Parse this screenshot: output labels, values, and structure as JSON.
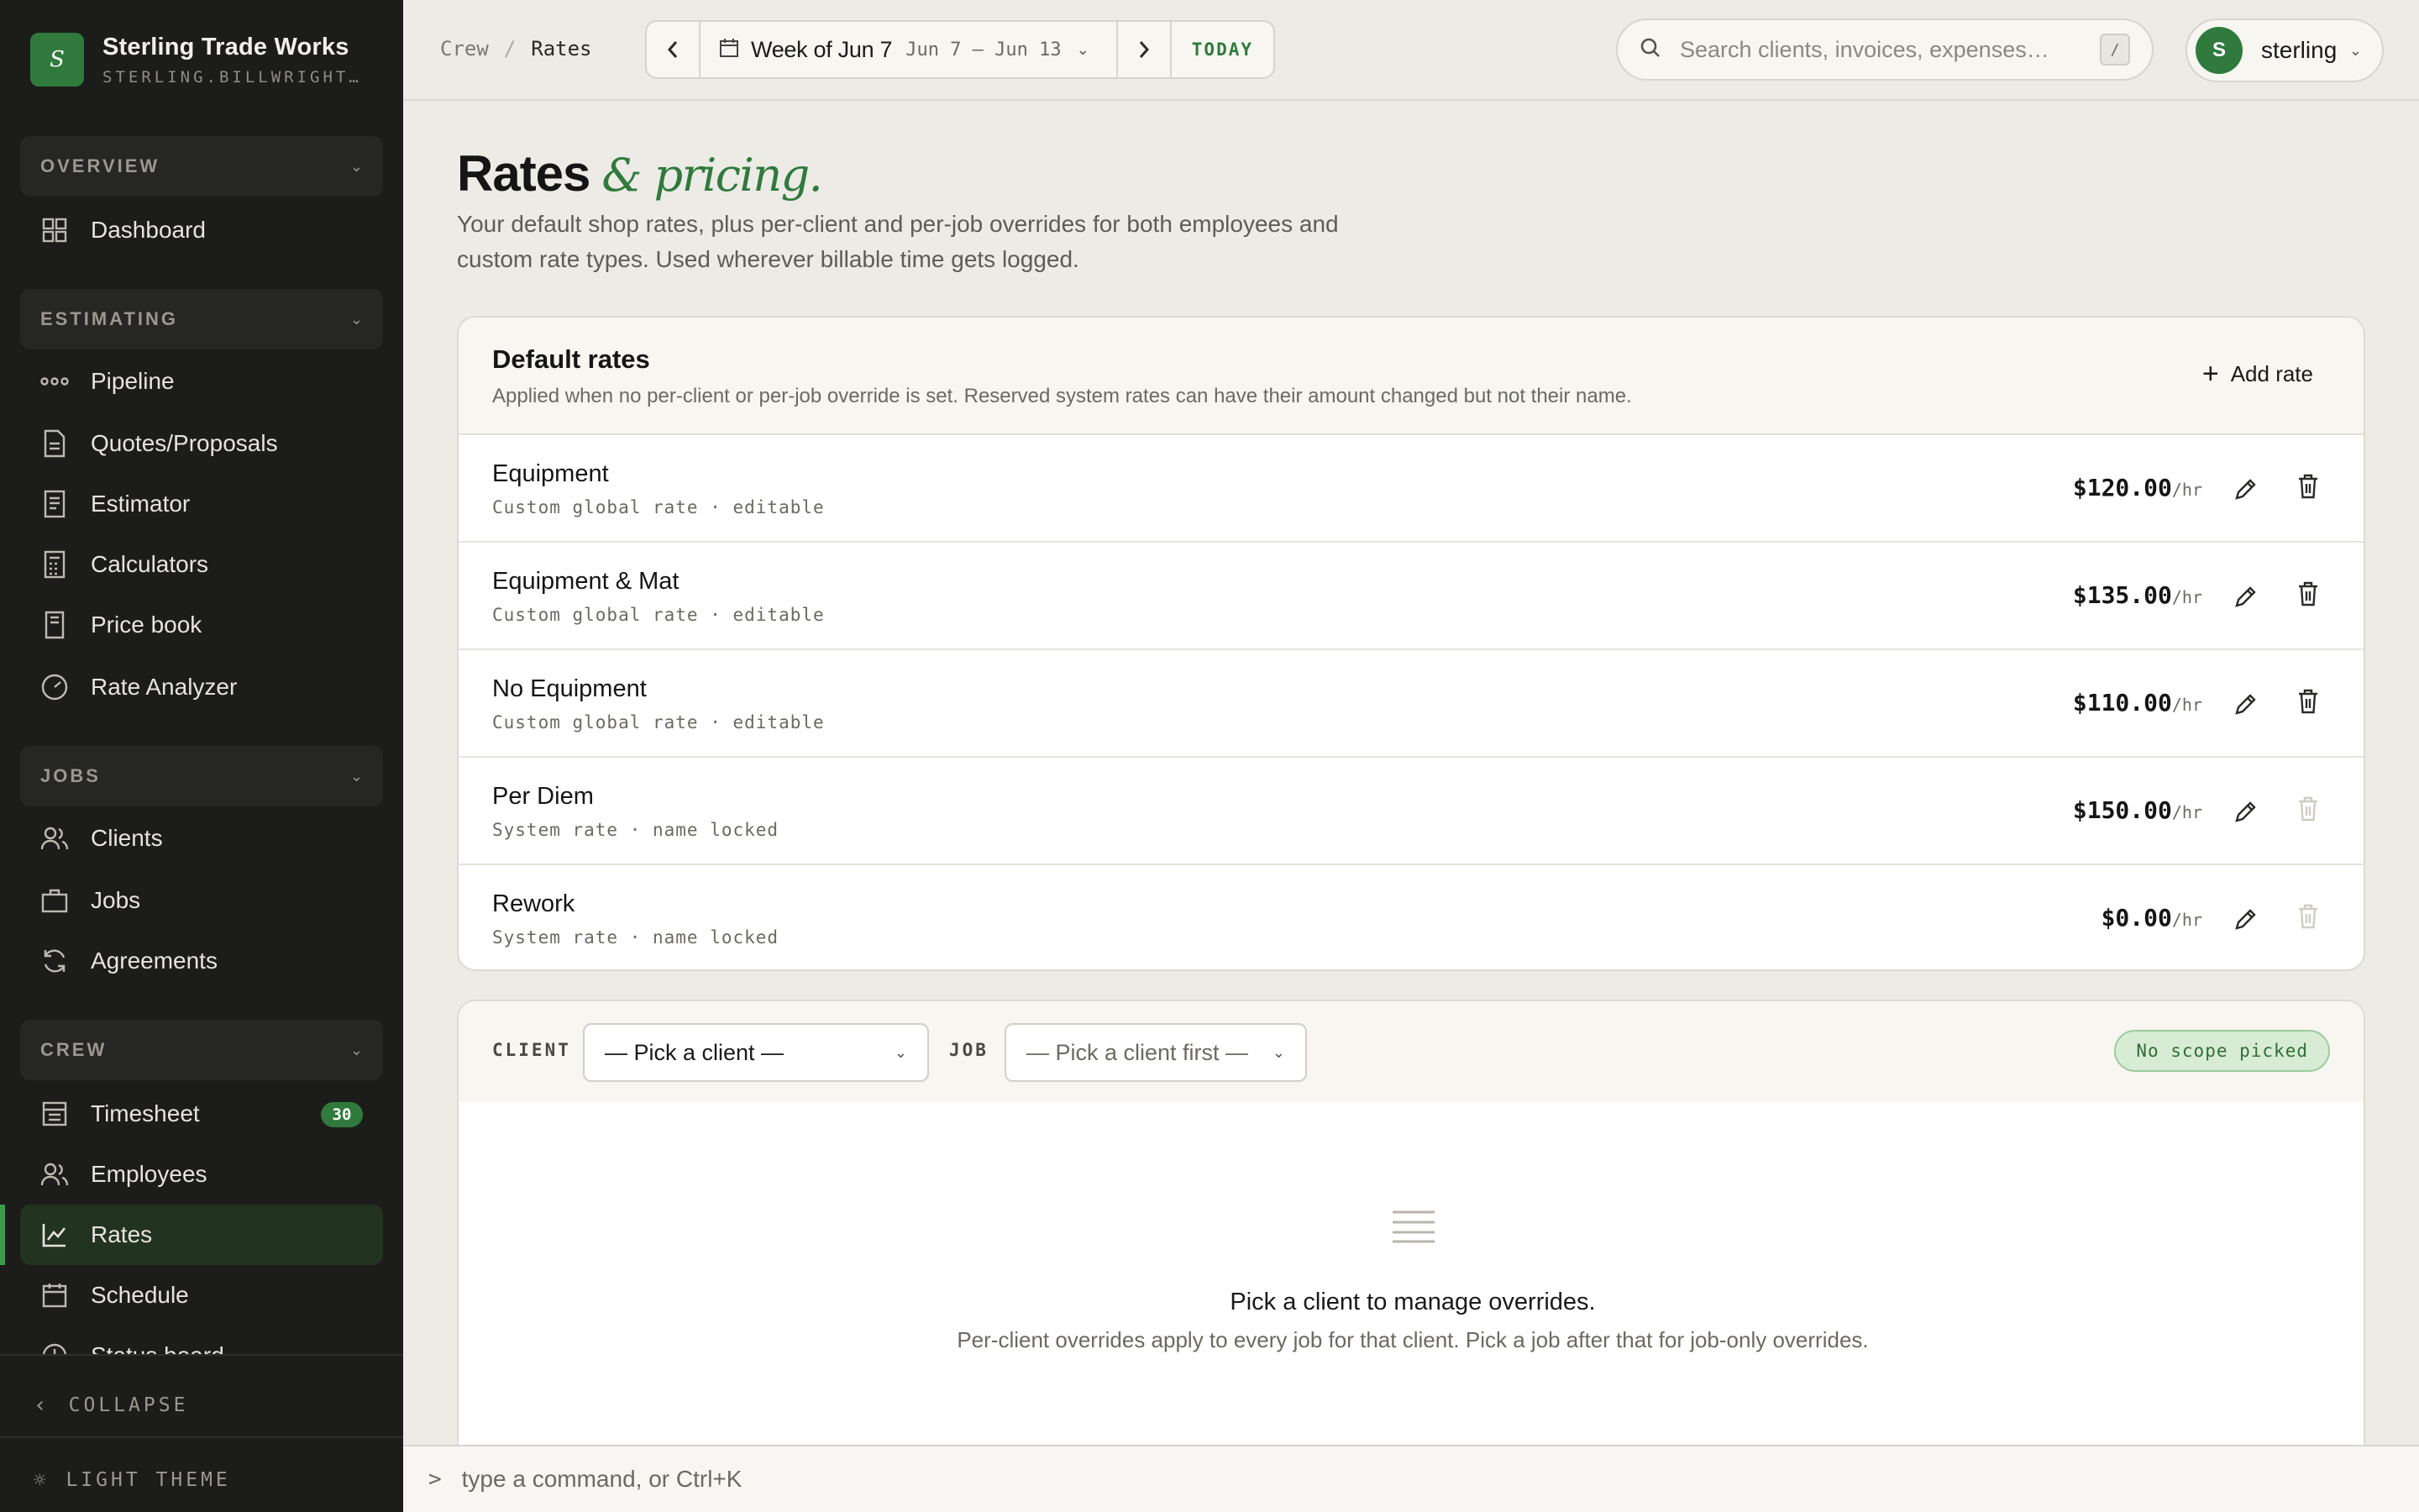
{
  "brand": {
    "name": "Sterling Trade Works",
    "domain": "STERLING.BILLWRIGHT.A…",
    "logo_letter": "S"
  },
  "sidebar": {
    "sections": [
      {
        "label": "OVERVIEW",
        "items": [
          {
            "label": "Dashboard",
            "icon": "grid-icon"
          }
        ]
      },
      {
        "label": "ESTIMATING",
        "items": [
          {
            "label": "Pipeline",
            "icon": "pipeline-icon"
          },
          {
            "label": "Quotes/Proposals",
            "icon": "document-icon"
          },
          {
            "label": "Estimator",
            "icon": "receipt-icon"
          },
          {
            "label": "Calculators",
            "icon": "calculator-icon"
          },
          {
            "label": "Price book",
            "icon": "book-icon"
          },
          {
            "label": "Rate Analyzer",
            "icon": "gauge-icon"
          }
        ]
      },
      {
        "label": "JOBS",
        "items": [
          {
            "label": "Clients",
            "icon": "users-icon"
          },
          {
            "label": "Jobs",
            "icon": "briefcase-icon"
          },
          {
            "label": "Agreements",
            "icon": "refresh-icon"
          }
        ]
      },
      {
        "label": "CREW",
        "items": [
          {
            "label": "Timesheet",
            "icon": "timesheet-icon",
            "badge": "30"
          },
          {
            "label": "Employees",
            "icon": "users-icon"
          },
          {
            "label": "Rates",
            "icon": "chart-icon",
            "active": true
          },
          {
            "label": "Schedule",
            "icon": "calendar-icon"
          },
          {
            "label": "Status board",
            "icon": "clock-icon"
          }
        ]
      }
    ],
    "collapse_label": "COLLAPSE",
    "theme_label": "LIGHT THEME"
  },
  "topbar": {
    "breadcrumb": [
      "Crew",
      "Rates"
    ],
    "week_title": "Week of Jun 7",
    "week_range": "Jun 7 – Jun 13",
    "today_label": "TODAY",
    "search_placeholder": "Search clients, invoices, expenses…",
    "search_shortcut": "/",
    "user_initial": "S",
    "user_name": "sterling"
  },
  "page": {
    "title": "Rates",
    "title_accent": "& pricing.",
    "description": "Your default shop rates, plus per-client and per-job overrides for both employees and custom rate types. Used wherever billable time gets logged."
  },
  "default_rates": {
    "title": "Default rates",
    "subtitle": "Applied when no per-client or per-job override is set. Reserved system rates can have their amount changed but not their name.",
    "add_label": "Add rate",
    "rows": [
      {
        "name": "Equipment",
        "meta": "Custom global rate · editable",
        "amount": "$120.00",
        "unit": "/hr",
        "deletable": true
      },
      {
        "name": "Equipment & Mat",
        "meta": "Custom global rate · editable",
        "amount": "$135.00",
        "unit": "/hr",
        "deletable": true
      },
      {
        "name": "No Equipment",
        "meta": "Custom global rate · editable",
        "amount": "$110.00",
        "unit": "/hr",
        "deletable": true
      },
      {
        "name": "Per Diem",
        "meta": "System rate · name locked",
        "amount": "$150.00",
        "unit": "/hr",
        "deletable": false
      },
      {
        "name": "Rework",
        "meta": "System rate · name locked",
        "amount": "$0.00",
        "unit": "/hr",
        "deletable": false
      }
    ]
  },
  "overrides": {
    "client_label": "CLIENT",
    "client_value": "— Pick a client —",
    "job_label": "JOB",
    "job_value": "— Pick a client first —",
    "scope_badge": "No scope picked",
    "empty_title": "Pick a client to manage overrides.",
    "empty_sub": "Per-client overrides apply to every job for that client. Pick a job after that for job-only overrides."
  },
  "command_bar": {
    "prompt": ">",
    "placeholder": "type a command, or Ctrl+K"
  },
  "colors": {
    "accent": "#2f7a3c",
    "sidebar_bg": "#1c1c1b",
    "page_bg": "#ecebe6"
  }
}
